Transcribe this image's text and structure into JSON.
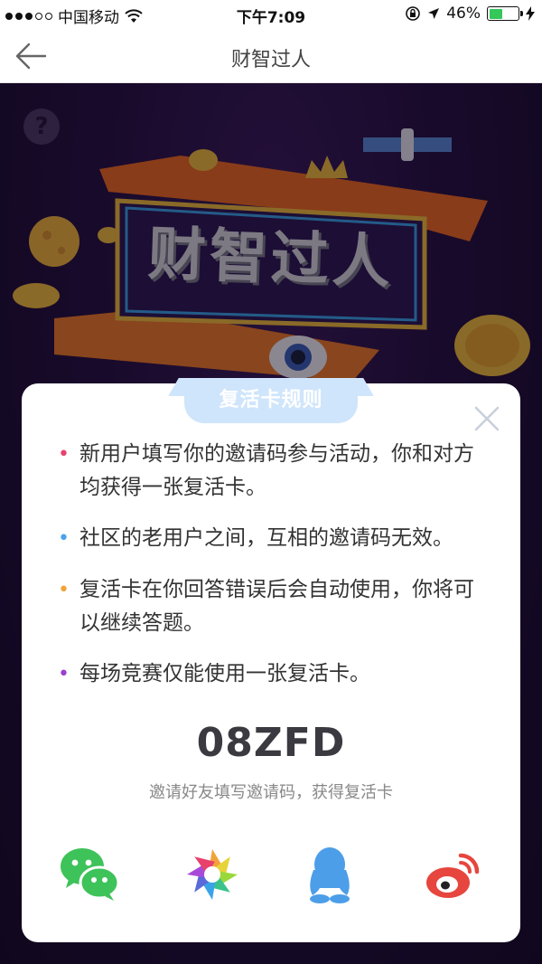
{
  "status_bar": {
    "carrier": "中国移动",
    "time": "下午7:09",
    "battery_text": "46%",
    "battery_level": 0.46
  },
  "nav": {
    "title": "财智过人",
    "back_icon": "back-arrow-icon"
  },
  "hero": {
    "help_label": "?",
    "logo_text": "财智过人"
  },
  "modal": {
    "tab_title": "复活卡规则",
    "rules": [
      {
        "text": "新用户填写你的邀请码参与活动，你和对方均获得一张复活卡。",
        "bullet_color": "#e8416b"
      },
      {
        "text": "社区的老用户之间，互相的邀请码无效。",
        "bullet_color": "#4aa3ec"
      },
      {
        "text": "复活卡在你回答错误后会自动使用，你将可以继续答题。",
        "bullet_color": "#f2a23a"
      },
      {
        "text": "每场竞赛仅能使用一张复活卡。",
        "bullet_color": "#9b3fd1"
      }
    ],
    "invite_code": "08ZFD",
    "hint": "邀请好友填写邀请码，获得复活卡",
    "share_targets": [
      {
        "icon": "wechat-icon",
        "color": "#3ec25a"
      },
      {
        "icon": "wechat-moments-icon",
        "color": "#f2a23a"
      },
      {
        "icon": "qq-icon",
        "color": "#4d9ee8"
      },
      {
        "icon": "weibo-icon",
        "color": "#e6463d"
      }
    ]
  },
  "colors": {
    "accent_tab": "#cfe5fb",
    "hero_background": "#24103f"
  }
}
